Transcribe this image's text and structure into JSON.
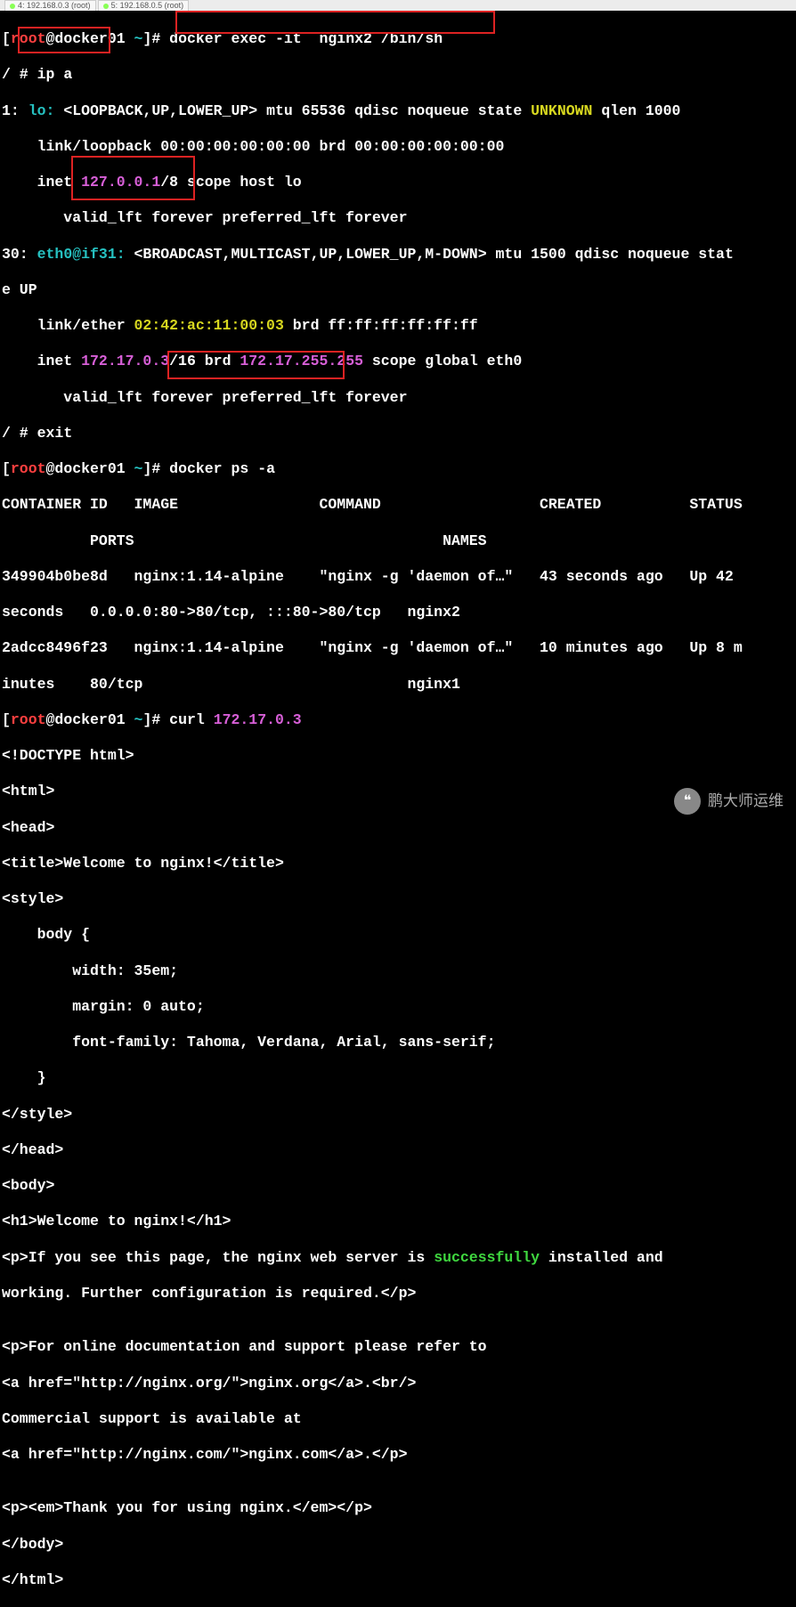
{
  "tabs": [
    {
      "label": "4: 192.168.0.3 (root)"
    },
    {
      "label": "5: 192.168.0.5 (root)"
    }
  ],
  "prompt": {
    "user": "root",
    "at": "@",
    "host": "docker01",
    "path": " ~",
    "hash": "]# "
  },
  "cmd": {
    "exec": "docker exec -it  nginx2 /bin/sh",
    "ipa": "ip a",
    "exit": "exit",
    "psa": "docker ps -a",
    "curl": "curl ",
    "curl_ip": "172.17.0.3"
  },
  "sh_prompt": "/ # ",
  "ip": {
    "l1_a": "1: ",
    "l1_lo": "lo: ",
    "l1_flags": "<LOOPBACK,UP,LOWER_UP>",
    "l1_rest": " mtu 65536 qdisc noqueue state ",
    "l1_state": "UNKNOWN",
    "l1_qlen": " qlen 1000",
    "l2": "    link/loopback 00:00:00:00:00:00 brd 00:00:00:00:00:00",
    "l3_a": "    inet ",
    "l3_ip": "127.0.0.1",
    "l3_b": "/8 scope host lo",
    "l4": "       valid_lft forever preferred_lft forever",
    "l5_a": "30: ",
    "l5_if": "eth0@if31: ",
    "l5_flags": "<BROADCAST,MULTICAST,UP,LOWER_UP,M-DOWN>",
    "l5_rest": " mtu 1500 qdisc noqueue stat",
    "l5_rest2": "e UP ",
    "l6_a": "    link/ether ",
    "l6_mac": "02:42:ac:11:00:03",
    "l6_b": " brd ff:ff:ff:ff:ff:ff",
    "l7_a": "    inet ",
    "l7_ip": "172.17.0.3",
    "l7_b": "/16 brd ",
    "l7_brd": "172.17.255.255",
    "l7_c": " scope global eth0",
    "l8": "       valid_lft forever preferred_lft forever"
  },
  "ps": {
    "hdr": "CONTAINER ID   IMAGE                COMMAND                  CREATED          STATUS",
    "hdr2": "          PORTS                                   NAMES",
    "r1": "349904b0be8d   nginx:1.14-alpine    \"nginx -g 'daemon of…\"   43 seconds ago   Up 42 ",
    "r1b": "seconds   0.0.0.0:80->80/tcp, :::80->80/tcp   nginx2",
    "r2": "2adcc8496f23   nginx:1.14-alpine    \"nginx -g 'daemon of…\"   10 minutes ago   Up 8 m",
    "r2b": "inutes    80/tcp                              nginx1"
  },
  "html": {
    "l01": "<!DOCTYPE html>",
    "l02": "<html>",
    "l03": "<head>",
    "l04": "<title>Welcome to nginx!</title>",
    "l05": "<style>",
    "l06": "    body {",
    "l07": "        width: 35em;",
    "l08": "        margin: 0 auto;",
    "l09": "        font-family: Tahoma, Verdana, Arial, sans-serif;",
    "l10": "    }",
    "l11": "</style>",
    "l12": "</head>",
    "l13": "<body>",
    "l14": "<h1>Welcome to nginx!</h1>",
    "l15a": "<p>If you see this page, the nginx web server is ",
    "l15b": "successfully",
    "l15c": " installed and ",
    "l16": "working. Further configuration is required.</p>",
    "blank": "",
    "l17": "<p>For online documentation and support please refer to",
    "l18": "<a href=\"http://nginx.org/\">nginx.org</a>.<br/>",
    "l19": "Commercial support is available at",
    "l20": "<a href=\"http://nginx.com/\">nginx.com</a>.</p>",
    "l21": "<p><em>Thank you for using nginx.</em></p>",
    "l22": "</body>",
    "l23": "</html>"
  },
  "watermark": "鹏大师运维"
}
